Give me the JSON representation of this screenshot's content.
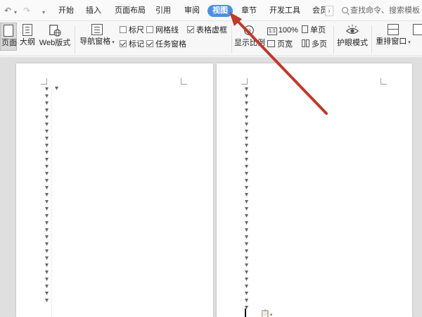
{
  "quick_access": {
    "undo_icon": "undo-icon",
    "redo_icon": "redo-icon",
    "customize_icon": "customize-dropdown-icon"
  },
  "tabs": [
    {
      "label": "开始",
      "active": false
    },
    {
      "label": "插入",
      "active": false
    },
    {
      "label": "页面布局",
      "active": false
    },
    {
      "label": "引用",
      "active": false
    },
    {
      "label": "审阅",
      "active": false
    },
    {
      "label": "视图",
      "active": true
    },
    {
      "label": "章节",
      "active": false
    },
    {
      "label": "开发工具",
      "active": false
    },
    {
      "label": "会员",
      "active": false
    }
  ],
  "search": {
    "placeholder": "查找命令、搜索模板"
  },
  "ribbon": {
    "views": {
      "page": "页面",
      "outline": "大纲",
      "web": "Web版式"
    },
    "nav_pane": "导航窗格",
    "checkboxes": {
      "ruler": {
        "label": "标尺",
        "checked": false
      },
      "gridlines": {
        "label": "网格线",
        "checked": false
      },
      "table_gridlines": {
        "label": "表格虚框",
        "checked": true
      },
      "markup": {
        "label": "标记",
        "checked": true
      },
      "task_pane": {
        "label": "任务窗格",
        "checked": true
      }
    },
    "zoom_ratio": "显示比例",
    "zoom_100": "100%",
    "page_width": "页宽",
    "single_page": "单页",
    "multi_page": "多页",
    "eye_protection": "护眼模式",
    "rearrange_window": "重排窗口"
  },
  "colors": {
    "active_tab": "#4a90e2",
    "arrow": "#c0392b",
    "workspace_bg": "#dfdfdf"
  }
}
